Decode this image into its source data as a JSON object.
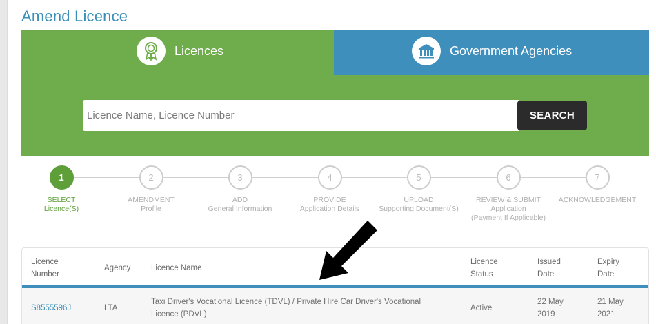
{
  "page": {
    "title": "Amend Licence"
  },
  "tabs": {
    "licences": {
      "label": "Licences",
      "icon": "award-ribbon-icon"
    },
    "agencies": {
      "label": "Government Agencies",
      "icon": "bank-building-icon"
    }
  },
  "search": {
    "placeholder": "Licence Name, Licence Number",
    "value": "",
    "button": "SEARCH"
  },
  "steps": [
    {
      "number": "1",
      "line1": "SELECT",
      "line2": "Licence(S)",
      "line3": "",
      "active": true
    },
    {
      "number": "2",
      "line1": "AMENDMENT",
      "line2": "Profile",
      "line3": ""
    },
    {
      "number": "3",
      "line1": "ADD",
      "line2": "General Information",
      "line3": ""
    },
    {
      "number": "4",
      "line1": "PROVIDE",
      "line2": "Application Details",
      "line3": ""
    },
    {
      "number": "5",
      "line1": "UPLOAD",
      "line2": "Supporting Document(S)",
      "line3": ""
    },
    {
      "number": "6",
      "line1": "REVIEW & SUBMIT",
      "line2": "Application",
      "line3": "(Payment If Applicable)"
    },
    {
      "number": "7",
      "line1": "ACKNOWLEDGEMENT",
      "line2": "",
      "line3": ""
    }
  ],
  "table": {
    "headers": {
      "number_1": "Licence",
      "number_2": "Number",
      "agency": "Agency",
      "name": "Licence Name",
      "status_1": "Licence",
      "status_2": "Status",
      "issued_1": "Issued",
      "issued_2": "Date",
      "expiry_1": "Expiry",
      "expiry_2": "Date"
    },
    "rows": [
      {
        "number": "S8555596J",
        "agency": "LTA",
        "name_1": "Taxi Driver's Vocational Licence (TDVL) / Private Hire Car Driver's Vocational",
        "name_2": "Licence (PDVL)",
        "status": "Active",
        "issued_1": "22 May",
        "issued_2": "2019",
        "expiry_1": "21 May",
        "expiry_2": "2021"
      }
    ]
  },
  "colors": {
    "panel_green": "#6fac4b",
    "agency_blue": "#3f8fbd",
    "title_blue": "#3a8fb7",
    "step_active": "#5e9f3a",
    "search_button": "#2b2b2b"
  }
}
